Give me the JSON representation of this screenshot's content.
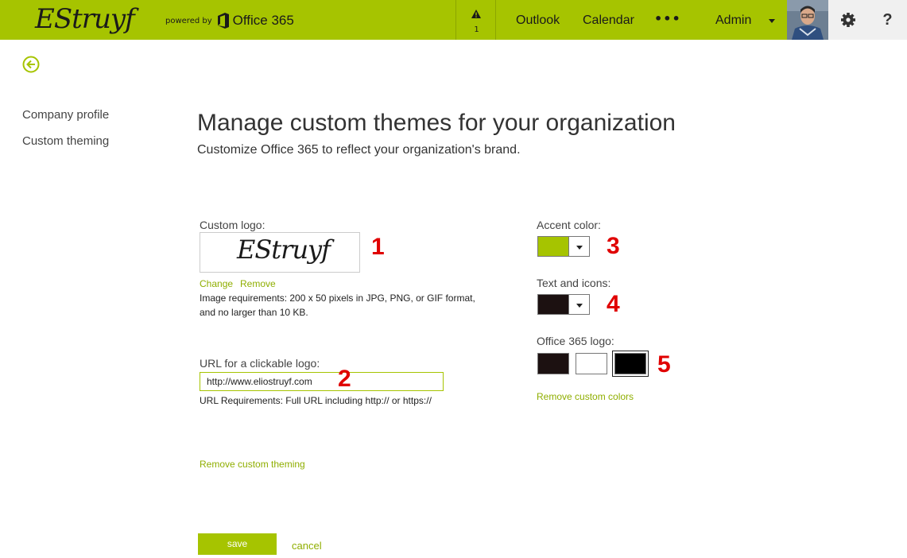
{
  "header": {
    "brand": "EStruyf",
    "powered_by": "powered by",
    "product": "Office 365",
    "alert_count": "1",
    "nav": [
      "Outlook",
      "Calendar"
    ],
    "more": "•••",
    "user": "Admin",
    "help": "?",
    "bar_color": "#a6c400"
  },
  "left_nav": {
    "items": [
      "Company profile",
      "Custom theming"
    ]
  },
  "page": {
    "title": "Manage custom themes for your organization",
    "subtitle": "Customize Office 365 to reflect your organization's brand."
  },
  "logo_section": {
    "label": "Custom logo:",
    "logo_text": "EStruyf",
    "change": "Change",
    "remove": "Remove",
    "req_line1": "Image requirements: 200 x 50 pixels in JPG, PNG, or GIF format,",
    "req_line2": "and no larger than 10 KB."
  },
  "url_section": {
    "label": "URL for a clickable logo:",
    "value": "http://www.eliostruyf.com",
    "requirements": "URL Requirements: Full URL including http:// or https://"
  },
  "remove_theming": "Remove custom theming",
  "colors": {
    "accent_label": "Accent color:",
    "accent_value": "#a6c400",
    "text_icons_label": "Text and icons:",
    "text_icons_value": "#1c1111",
    "o365_logo_label": "Office 365 logo:",
    "o365_logo_options": [
      "#1c1111",
      "#ffffff",
      "#000000"
    ],
    "remove_colors": "Remove custom colors"
  },
  "annotations": [
    "1",
    "2",
    "3",
    "4",
    "5"
  ],
  "actions": {
    "save": "save",
    "cancel": "cancel"
  }
}
